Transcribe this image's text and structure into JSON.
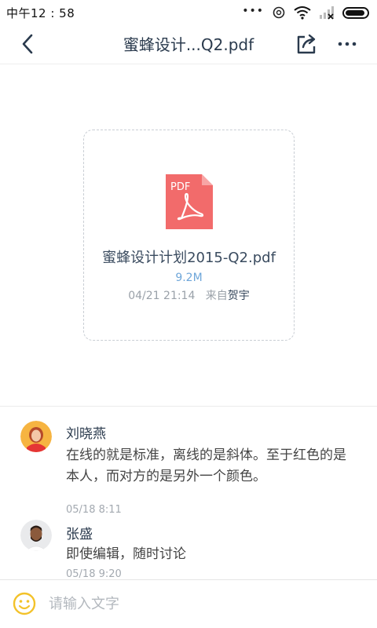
{
  "status_bar": {
    "time": "中午12 : 58",
    "icons": [
      "more-dots-icon",
      "sync-icon",
      "wifi-icon",
      "signal-icon",
      "battery-icon"
    ]
  },
  "nav": {
    "title": "蜜蜂设计...Q2.pdf",
    "icons": [
      "back-icon",
      "share-icon",
      "more-icon"
    ]
  },
  "file": {
    "icon_label": "PDF",
    "name": "蜜蜂设计计划2015-Q2.pdf",
    "size": "9.2M",
    "date": "04/21  21:14",
    "from_prefix": "来自",
    "sender": "贺宇",
    "colors": {
      "pdf_icon": "#f26b6b",
      "size_text": "#6ea6d9"
    }
  },
  "comments": [
    {
      "name": "刘晓燕",
      "text": "在线的就是标准，离线的是斜体。至于红色的是本人，而对方的是另外一个颜色。",
      "time": "05/18 8:11",
      "avatar": "woman-avatar"
    },
    {
      "name": "张盛",
      "text": "即使编辑，随时讨论",
      "time": "05/18 9:20",
      "avatar": "man-avatar"
    }
  ],
  "input": {
    "placeholder": "请输入文字",
    "value": "",
    "icon": "emoji-icon"
  }
}
